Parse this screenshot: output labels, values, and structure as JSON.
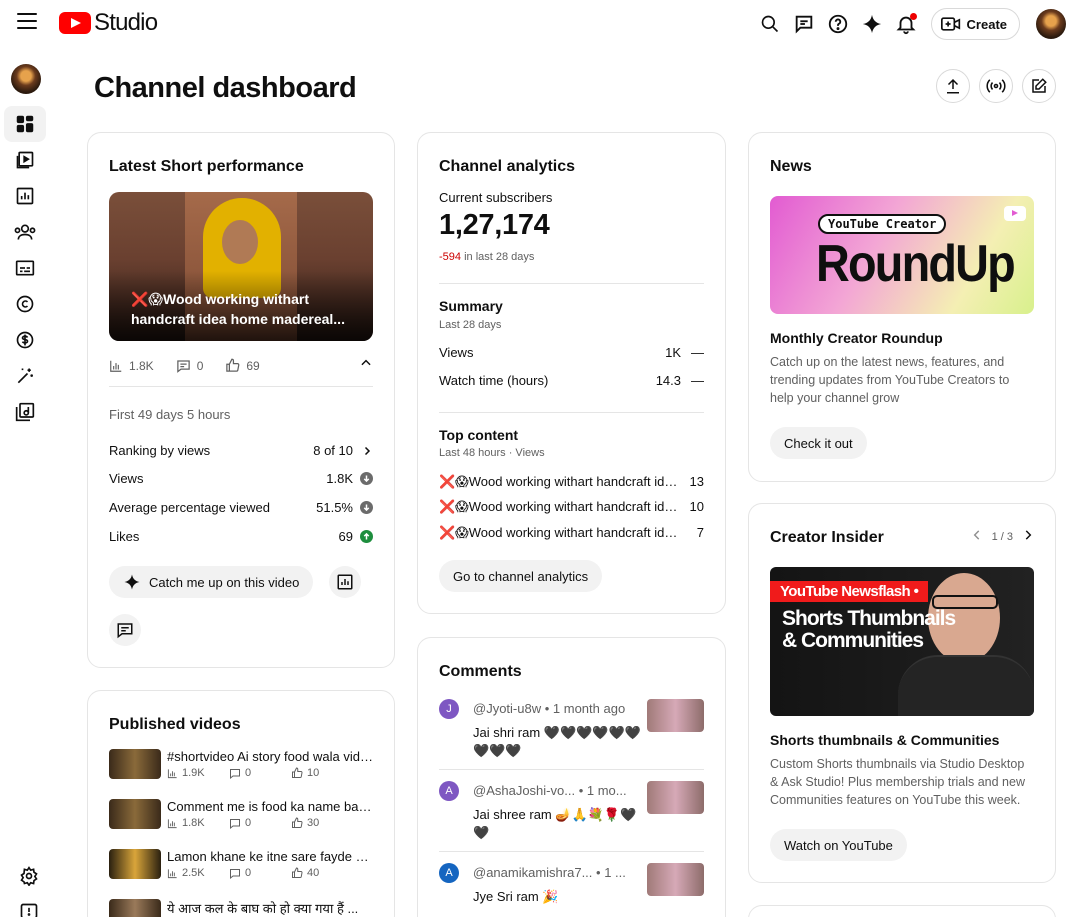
{
  "header": {
    "logo_text": "Studio",
    "create_label": "Create"
  },
  "page": {
    "title": "Channel dashboard"
  },
  "short_card": {
    "title": "Latest Short performance",
    "thumb_caption": "❌😱Wood working withart handcraft idea home madereal...",
    "stats": {
      "views": "1.8K",
      "comments": "0",
      "likes": "69"
    },
    "period": "First 49 days 5 hours",
    "rows": [
      {
        "label": "Ranking by views",
        "value": "8 of 10",
        "trend": "chevron"
      },
      {
        "label": "Views",
        "value": "1.8K",
        "trend": "down"
      },
      {
        "label": "Average percentage viewed",
        "value": "51.5%",
        "trend": "down"
      },
      {
        "label": "Likes",
        "value": "69",
        "trend": "up"
      }
    ],
    "catch_up_label": "Catch me up on this video"
  },
  "analytics_card": {
    "title": "Channel analytics",
    "subs_label": "Current subscribers",
    "subs_value": "1,27,174",
    "subs_change": "-594",
    "subs_change_suffix": " in last 28 days",
    "summary_title": "Summary",
    "summary_period": "Last 28 days",
    "summary_rows": [
      {
        "label": "Views",
        "value": "1K",
        "trend": "—"
      },
      {
        "label": "Watch time (hours)",
        "value": "14.3",
        "trend": "—"
      }
    ],
    "top_title": "Top content",
    "top_period": "Last 48 hours · Views",
    "top_items": [
      {
        "title": "❌😱Wood working withart handcraft ide...",
        "value": "13"
      },
      {
        "title": "❌😱Wood working withart handcraft ide...",
        "value": "10"
      },
      {
        "title": "❌😱Wood working withart handcraft ide...",
        "value": "7"
      }
    ],
    "button_label": "Go to channel analytics"
  },
  "news_card": {
    "title": "News",
    "thumb_tag": "YouTube Creator",
    "thumb_big": "RoundUp",
    "headline": "Monthly Creator Roundup",
    "body": "Catch up on the latest news, features, and trending updates from YouTube Creators to help your channel grow",
    "button_label": "Check it out"
  },
  "insider_card": {
    "title": "Creator Insider",
    "pager": "1 / 3",
    "thumb_badge": "YouTube Newsflash •",
    "thumb_line1": "Shorts Thumbnails",
    "thumb_line2": "& Communities",
    "headline": "Shorts thumbnails & Communities",
    "body": "Custom Shorts thumbnails via Studio Desktop & Ask Studio! Plus membership trials and new Communities features on YouTube this week.",
    "button_label": "Watch on YouTube"
  },
  "comments_card": {
    "title": "Comments",
    "items": [
      {
        "initial": "J",
        "color": "#7e57c2",
        "author": "@Jyoti-u8w",
        "time": "• 1 month ago",
        "text": "Jai shri ram 🖤🖤🖤🖤🖤🖤🖤🖤🖤"
      },
      {
        "initial": "A",
        "color": "#7e57c2",
        "author": "@AshaJoshi-vo...",
        "time": "• 1 mo...",
        "text": "Jai shree ram 🪔🙏💐🌹🖤🖤"
      },
      {
        "initial": "A",
        "color": "#1565c0",
        "author": "@anamikamishra7...",
        "time": "• 1 ...",
        "text": "Jye Sri ram 🎉"
      }
    ]
  },
  "published_card": {
    "title": "Published videos",
    "items": [
      {
        "title": "#shortvideo Ai story food wala vide...",
        "views": "1.9K",
        "comments": "0",
        "likes": "10"
      },
      {
        "title": "Comment me is food ka name bata...",
        "views": "1.8K",
        "comments": "0",
        "likes": "30"
      },
      {
        "title": "Lamon khane ke itne sare fayde 😱 ...",
        "views": "2.5K",
        "comments": "0",
        "likes": "40"
      },
      {
        "title": "ये आज कल के बाघ को हो क्या गया हैं ..."
      }
    ]
  }
}
